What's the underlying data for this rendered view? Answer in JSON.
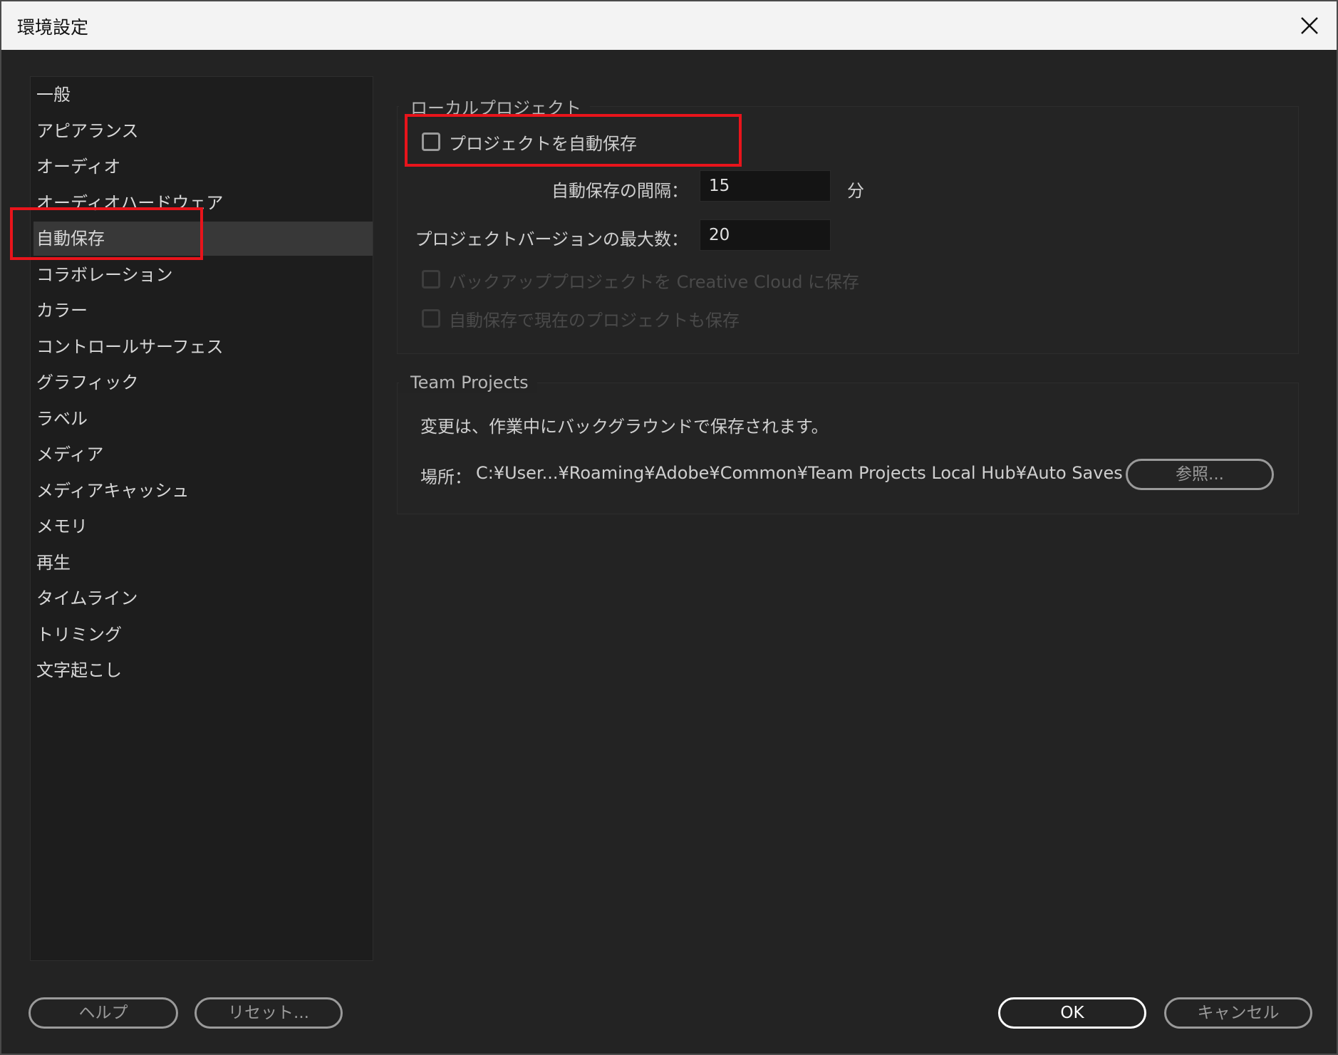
{
  "window": {
    "title": "環境設定"
  },
  "sidebar": {
    "items": [
      {
        "label": "一般"
      },
      {
        "label": "アピアランス"
      },
      {
        "label": "オーディオ"
      },
      {
        "label": "オーディオハードウェア"
      },
      {
        "label": "自動保存",
        "selected": true
      },
      {
        "label": "コラボレーション"
      },
      {
        "label": "カラー"
      },
      {
        "label": "コントロールサーフェス"
      },
      {
        "label": "グラフィック"
      },
      {
        "label": "ラベル"
      },
      {
        "label": "メディア"
      },
      {
        "label": "メディアキャッシュ"
      },
      {
        "label": "メモリ"
      },
      {
        "label": "再生"
      },
      {
        "label": "タイムライン"
      },
      {
        "label": "トリミング"
      },
      {
        "label": "文字起こし"
      }
    ]
  },
  "local_project": {
    "title": "ローカルプロジェクト",
    "auto_save_label": "プロジェクトを自動保存",
    "auto_save_checked": false,
    "interval_label": "自動保存の間隔：",
    "interval_value": "15",
    "interval_unit": "分",
    "max_versions_label": "プロジェクトバージョンの最大数：",
    "max_versions_value": "20",
    "backup_cc_label": "バックアッププロジェクトを Creative Cloud に保存",
    "save_current_label": "自動保存で現在のプロジェクトも保存"
  },
  "team_projects": {
    "title": "Team Projects",
    "description": "変更は、作業中にバックグラウンドで保存されます。",
    "location_label": "場所：",
    "location_path": "C:¥User...¥Roaming¥Adobe¥Common¥Team Projects Local Hub¥Auto Saves",
    "browse_label": "参照..."
  },
  "footer": {
    "help_label": "ヘルプ",
    "reset_label": "リセット...",
    "ok_label": "OK",
    "cancel_label": "キャンセル"
  },
  "colors": {
    "background": "#232323",
    "sidebar_bg": "#1d1d1d",
    "selected_bg": "#383838",
    "highlight": "#e8141b"
  }
}
